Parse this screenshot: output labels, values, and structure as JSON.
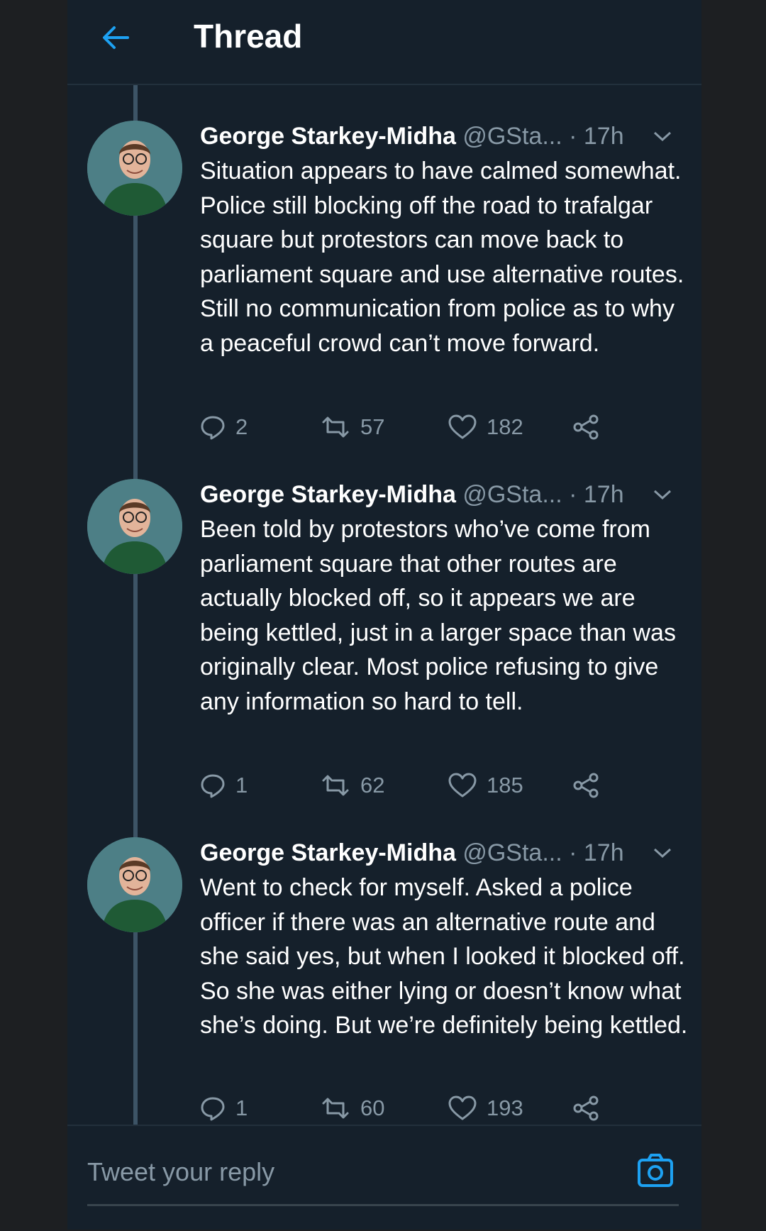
{
  "header": {
    "title": "Thread",
    "back_icon": "arrow-left-icon"
  },
  "colors": {
    "background": "#15202b",
    "accent": "#1da1f2",
    "muted": "#8899a6",
    "text": "#ffffff"
  },
  "tweets": [
    {
      "name": "George Starkey-Midha",
      "meta": "@GSta... · 17h",
      "text": "Situation appears to have calmed somewhat. Police still blocking off the road to trafalgar square but protestors can move back to parliament square and use alternative routes. Still no communication from police as to why a peaceful crowd can’t move forward.",
      "replies": "2",
      "retweets": "57",
      "likes": "182"
    },
    {
      "name": "George Starkey-Midha",
      "meta": "@GSta... · 17h",
      "text": "Been told by protestors who’ve come from parliament square that other routes are actually blocked off, so it appears we are being kettled, just in a larger space than was originally clear. Most police refusing to give any information so hard to tell.",
      "replies": "1",
      "retweets": "62",
      "likes": "185"
    },
    {
      "name": "George Starkey-Midha",
      "meta": "@GSta... · 17h",
      "text": "Went to check for myself. Asked a police officer if there was an alternative route and she said yes, but when I looked it blocked off. So she was either lying or doesn’t know what she’s doing. But we’re definitely being kettled.",
      "replies": "1",
      "retweets": "60",
      "likes": "193"
    }
  ],
  "reply_box": {
    "placeholder": "Tweet your reply",
    "camera_icon": "camera-icon"
  }
}
